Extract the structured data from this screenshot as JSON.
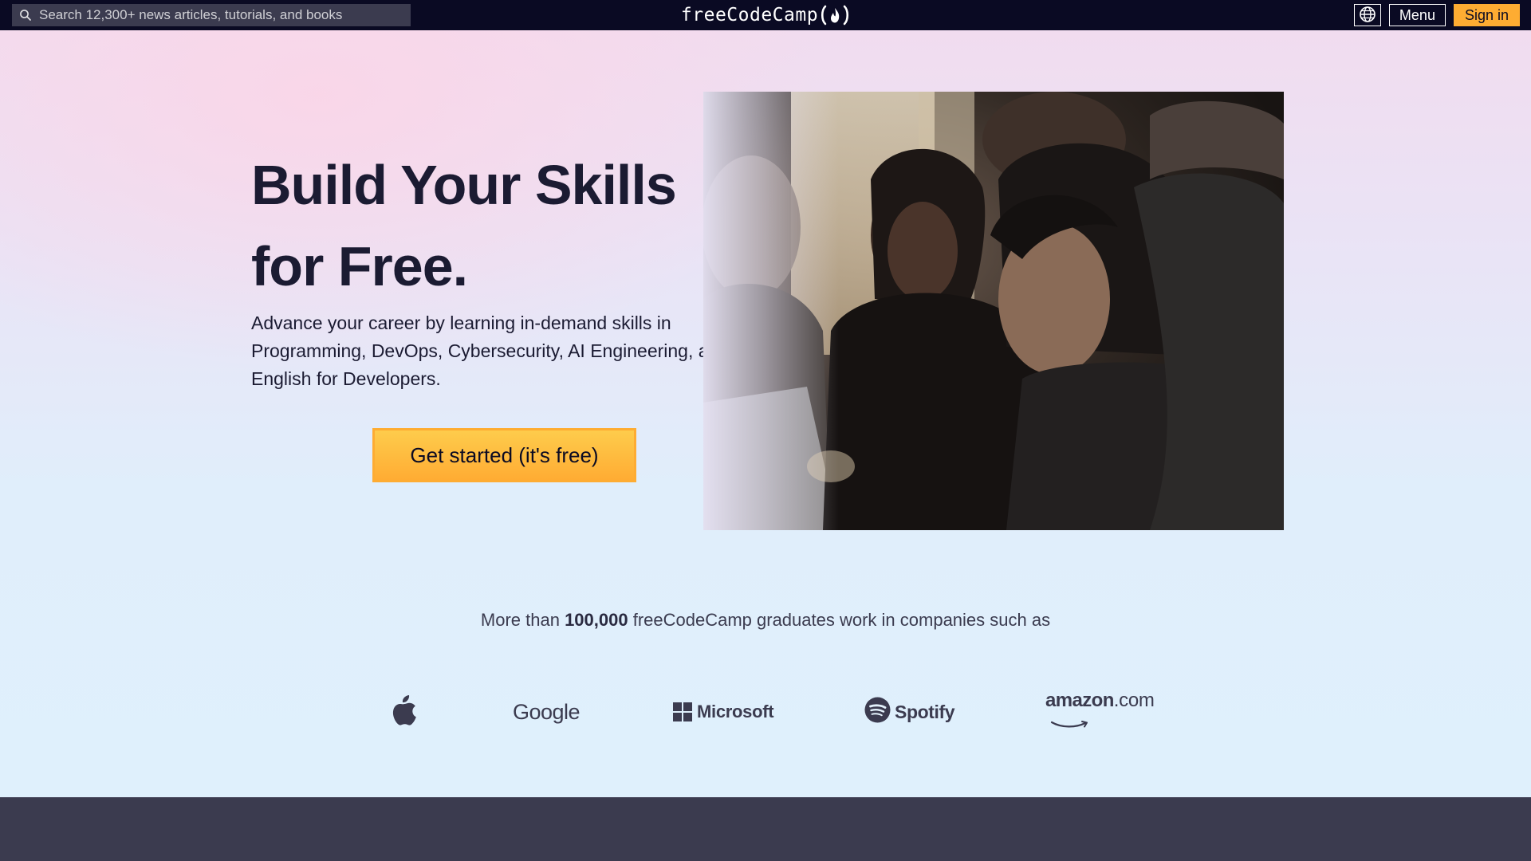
{
  "nav": {
    "search_placeholder": "Search 12,300+ news articles, tutorials, and books",
    "brand_text": "freeCodeCamp",
    "menu_label": "Menu",
    "signin_label": "Sign in",
    "icons": [
      "search-icon",
      "flame-icon",
      "globe-icon"
    ]
  },
  "hero": {
    "title": "Build Your Skills for Free.",
    "description": "Advance your career by learning in-demand skills in Programming, DevOps, Cybersecurity, AI Engineering, and English for Developers.",
    "cta_label": "Get started (it's free)"
  },
  "proof": {
    "prefix": "More than ",
    "count": "100,000",
    "suffix": " freeCodeCamp graduates work in companies such as"
  },
  "companies": {
    "apple_icon": "apple-logo-icon",
    "google": "Google",
    "microsoft": "Microsoft",
    "spotify": "Spotify",
    "amazon_main": "amazon",
    "amazon_tld": ".com"
  },
  "colors": {
    "nav_bg": "#0a0a23",
    "accent": "#feac32",
    "text_dark": "#1b1b32",
    "footer_band": "#3b3b4f"
  }
}
